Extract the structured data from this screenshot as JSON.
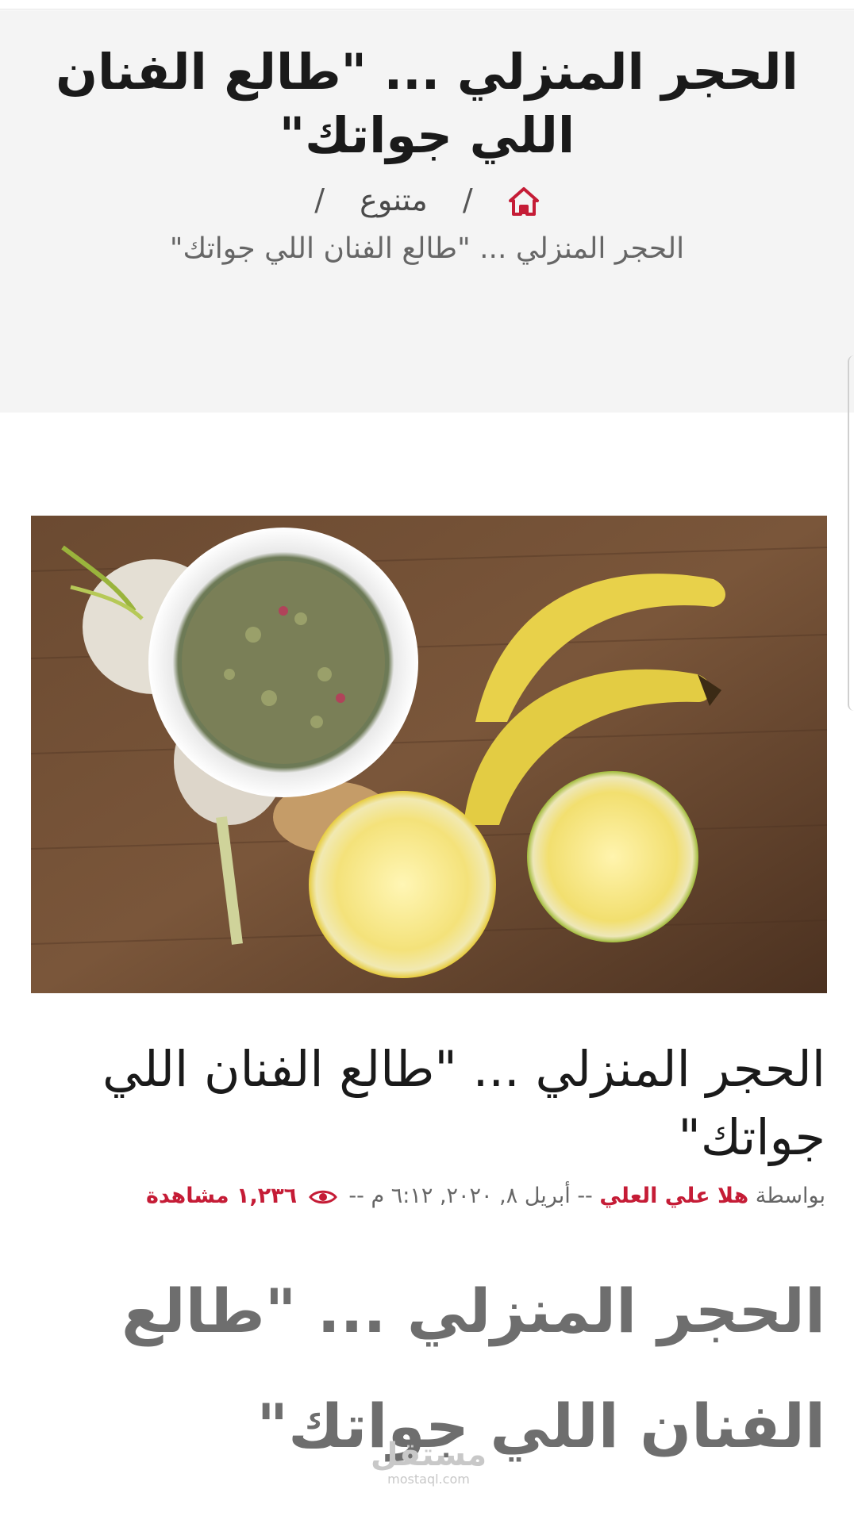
{
  "hero": {
    "title": "الحجر المنزلي ... \"طالع الفنان اللي جواتك\"",
    "breadcrumb": {
      "home_icon": "home-icon",
      "category": "متنوع",
      "separator": "/",
      "current": "الحجر المنزلي ... \"طالع الفنان اللي جواتك\""
    }
  },
  "article": {
    "title": "الحجر المنزلي ... \"طالع الفنان اللي جواتك\"",
    "meta": {
      "by_label": "بواسطة",
      "author": "هلا علي العلي",
      "dash": "--",
      "date": "أبريل ٨, ٢٠٢٠, ٦:١٢ م",
      "views_icon": "eye-icon",
      "views": "١,٢٣٦ مشاهدة"
    },
    "body_heading": "الحجر المنزلي ... \"طالع الفنان اللي جواتك\""
  },
  "watermark": {
    "arabic": "مستقل",
    "latin": "mostaql.com"
  },
  "colors": {
    "accent": "#c51c36",
    "hero_bg": "#f4f4f4"
  }
}
